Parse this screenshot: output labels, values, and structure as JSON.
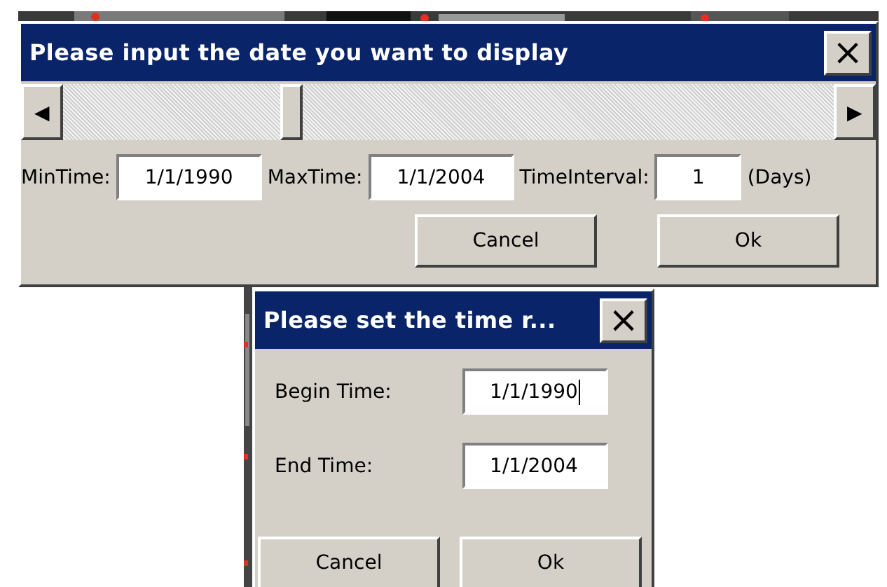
{
  "date_dialog": {
    "title": "Please input the date you want to display",
    "close": "×",
    "slider": {
      "left_arrow": "◀",
      "right_arrow": "▶",
      "level": 0.29
    },
    "fields": [
      {
        "label": "MinTime:",
        "value": "1/1/1990"
      },
      {
        "label": "MaxTime:",
        "value": "1/1/2004"
      },
      {
        "label": "TimeInterval:",
        "value": "1",
        "unit": "(Days)"
      }
    ],
    "buttons": [
      "Cancel",
      "Ok"
    ]
  },
  "range_dialog": {
    "title": "Please set the time r...",
    "close": "×",
    "fields": [
      {
        "label": "Begin Time:",
        "value": "1/1/1990",
        "focused": true
      },
      {
        "label": "End Time:",
        "value": "1/1/2004",
        "focused": false
      }
    ],
    "buttons": [
      "Cancel",
      "Ok"
    ]
  }
}
